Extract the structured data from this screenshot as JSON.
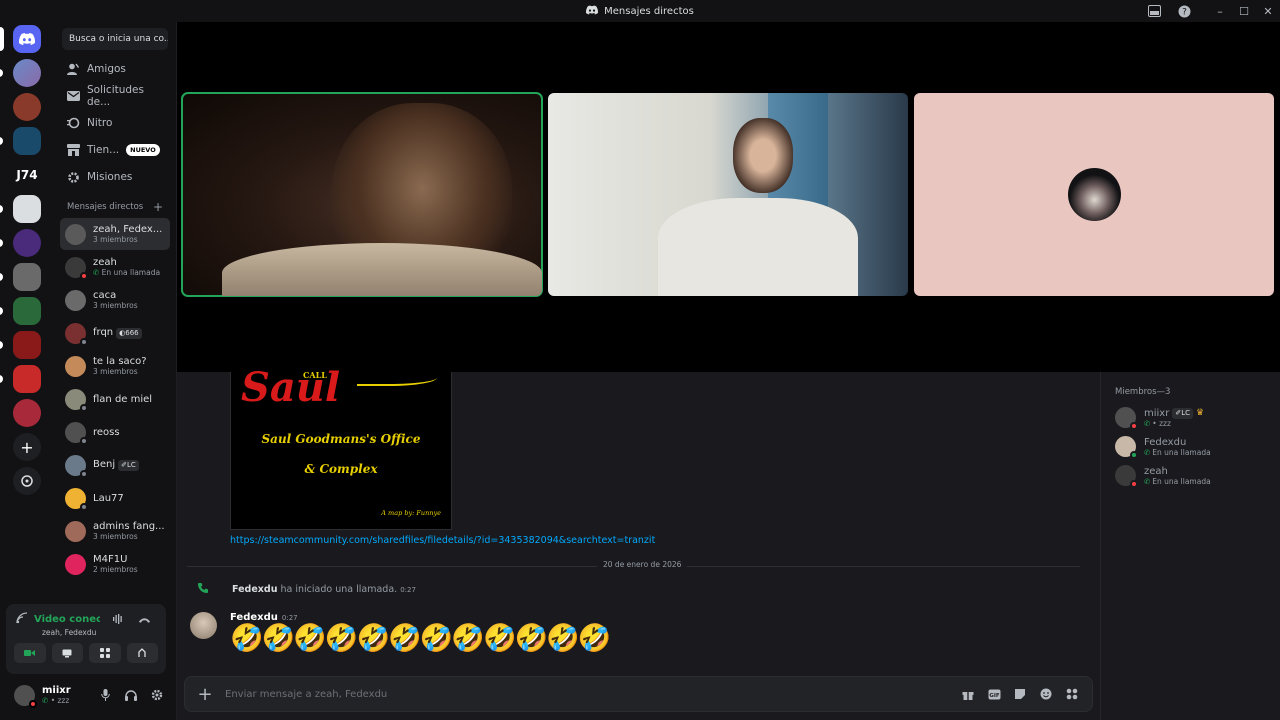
{
  "window": {
    "title": "Mensajes directos"
  },
  "search": {
    "placeholder": "Busca o inicia una co..."
  },
  "nav": [
    {
      "label": "Amigos",
      "icon": "friends-icon"
    },
    {
      "label": "Solicitudes de...",
      "icon": "envelope-icon"
    },
    {
      "label": "Nitro",
      "icon": "nitro-icon"
    },
    {
      "label": "Tien...",
      "icon": "shop-icon",
      "badge": "NUEVO"
    },
    {
      "label": "Misiones",
      "icon": "quests-icon"
    }
  ],
  "dm_header": "Mensajes directos",
  "dms": [
    {
      "name": "zeah, Fedex...",
      "sub": "3 miembros",
      "color": "#5a5a5a",
      "selected": true
    },
    {
      "name": "zeah",
      "sub": "En una llamada",
      "color": "#3a3a3a",
      "status": "dnd"
    },
    {
      "name": "caca",
      "sub": "3 miembros",
      "color": "#6a6a6a"
    },
    {
      "name": "frqn",
      "tag": "666",
      "color": "#7a3030",
      "status": "offline"
    },
    {
      "name": "te la saco?",
      "sub": "3 miembros",
      "color": "#c48a5a"
    },
    {
      "name": "flan de miel",
      "color": "#8a8a7a",
      "status": "offline"
    },
    {
      "name": "reoss",
      "color": "#505050",
      "status": "offline"
    },
    {
      "name": "Benj",
      "tag": "LC",
      "color": "#6a7a8a",
      "status": "offline"
    },
    {
      "name": "Lau77",
      "color": "#f0b232",
      "status": "offline"
    },
    {
      "name": "admins fang...",
      "sub": "3 miembros",
      "color": "#a06a5a"
    },
    {
      "name": "M4F1U",
      "sub": "2 miembros",
      "color": "#e0245e"
    }
  ],
  "voice_panel": {
    "title": "Video conecta",
    "sub": "zeah, Fedexdu"
  },
  "user": {
    "name": "miixr",
    "status": "• zzz"
  },
  "chat": {
    "embed": {
      "line1": "CALL",
      "line2": "Saul",
      "line3": "Saul Goodmans's Office",
      "line4": "& Complex",
      "credit": "A map by: Funnye"
    },
    "link": "https://steamcommunity.com/sharedfiles/filedetails/?id=3435382094&searchtext=tranzit",
    "date_divider": "20 de enero de 2026",
    "system": {
      "user": "Fedexdu",
      "text": "ha iniciado una llamada.",
      "time": "0:27"
    },
    "message": {
      "author": "Fedexdu",
      "time": "0:27",
      "content": "🤣🤣🤣🤣🤣🤣🤣🤣🤣🤣🤣🤣"
    },
    "composer_placeholder": "Enviar mensaje a zeah, Fedexdu"
  },
  "members": {
    "header": "Miembros—3",
    "list": [
      {
        "name": "miixr",
        "tag": "LC",
        "owner": true,
        "sub": "• zzz",
        "color": "#505050",
        "status": "dnd"
      },
      {
        "name": "Fedexdu",
        "sub": "En una llamada",
        "color": "#c8b8a8",
        "status": "online"
      },
      {
        "name": "zeah",
        "sub": "En una llamada",
        "color": "#3a3a3a",
        "status": "dnd"
      }
    ]
  },
  "colors": {
    "accent": "#5865f2",
    "online": "#23a559",
    "dnd": "#f23f43",
    "link": "#00a8fc"
  }
}
